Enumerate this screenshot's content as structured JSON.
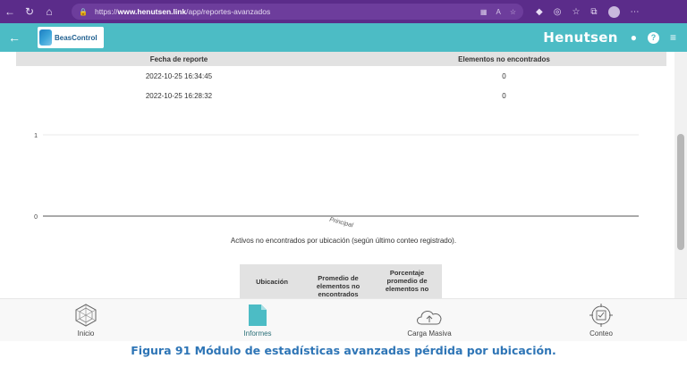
{
  "browser": {
    "url_prefix": "https://",
    "url_host": "www.henutsen.link",
    "url_path": "/app/reportes-avanzados"
  },
  "header": {
    "logo_text": "BeasControl",
    "brand": "Henutsen"
  },
  "report_table": {
    "columns": [
      "Fecha de reporte",
      "Elementos no encontrados"
    ],
    "rows": [
      [
        "2022-10-25 16:34:45",
        "0"
      ],
      [
        "2022-10-25 16:28:32",
        "0"
      ]
    ]
  },
  "chart_data": {
    "type": "bar",
    "categories": [
      "Principal"
    ],
    "values": [
      0
    ],
    "title": "Activos no encontrados por ubicación (según último conteo registrado).",
    "xlabel": "",
    "ylabel": "",
    "ylim": [
      0,
      1
    ],
    "yticks": [
      "0",
      "1"
    ],
    "grid": true
  },
  "stats_table": {
    "columns": [
      "Ubicación",
      "Promedio de elementos no encontrados",
      "Porcentaje promedio de elementos no"
    ]
  },
  "bottom_nav": {
    "items": [
      {
        "label": "Inicio",
        "icon": "radar-chart-icon"
      },
      {
        "label": "Informes",
        "icon": "document-icon"
      },
      {
        "label": "Carga Masiva",
        "icon": "cloud-upload-icon"
      },
      {
        "label": "Conteo",
        "icon": "count-target-icon"
      }
    ],
    "active_index": 1
  },
  "figure_caption": "Figura 91 Módulo de estadísticas avanzadas pérdida por ubicación.",
  "colors": {
    "browser": "#5b2c8a",
    "header": "#4cbcc5",
    "caption": "#2e75b6"
  }
}
